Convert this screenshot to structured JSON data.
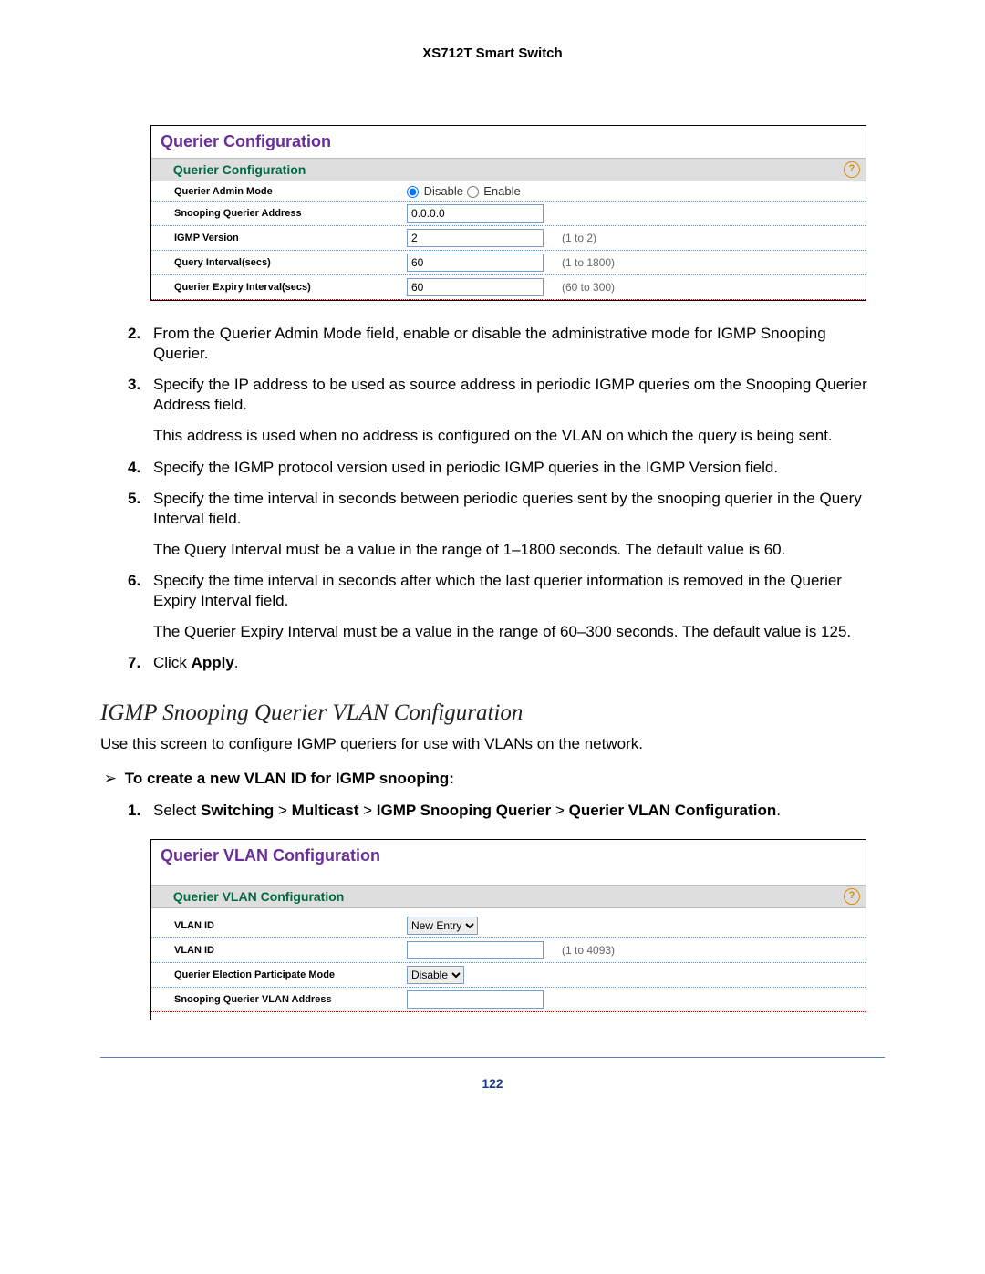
{
  "header": "XS712T Smart Switch",
  "panel1": {
    "title": "Querier Configuration",
    "subtitle": "Querier Configuration",
    "rows": {
      "admin_mode_label": "Querier Admin Mode",
      "disable": "Disable",
      "enable": "Enable",
      "snoop_addr_label": "Snooping Querier Address",
      "snoop_addr_val": "0.0.0.0",
      "igmp_ver_label": "IGMP Version",
      "igmp_ver_val": "2",
      "igmp_ver_hint": "(1 to 2)",
      "query_int_label": "Query Interval(secs)",
      "query_int_val": "60",
      "query_int_hint": "(1 to 1800)",
      "expiry_label": "Querier Expiry Interval(secs)",
      "expiry_val": "60",
      "expiry_hint": "(60 to 300)"
    }
  },
  "steps1": {
    "s2_num": "2.",
    "s2": "From the Querier Admin Mode field, enable or disable the administrative mode for IGMP Snooping Querier.",
    "s3_num": "3.",
    "s3": "Specify the IP address to be used as source address in periodic IGMP queries om the Snooping Querier Address field.",
    "s3p": "This address is used when no address is configured on the VLAN on which the query is being sent.",
    "s4_num": "4.",
    "s4": "Specify the IGMP protocol version used in periodic IGMP queries in the IGMP Version field.",
    "s5_num": "5.",
    "s5": "Specify the time interval in seconds between periodic queries sent by the snooping querier in the Query Interval field.",
    "s5p": "The Query Interval must be a value in the range of 1–1800 seconds. The default value is 60.",
    "s6_num": "6.",
    "s6": "Specify the time interval in seconds after which the last querier information is removed in the Querier Expiry Interval field.",
    "s6p": "The Querier Expiry Interval must be a value in the range of 60–300 seconds. The default value is 125.",
    "s7_num": "7.",
    "s7a": "Click ",
    "s7b": "Apply",
    "s7c": "."
  },
  "section2": {
    "heading": "IGMP Snooping Querier VLAN Configuration",
    "intro": "Use this screen to configure IGMP queriers for use with VLANs on the network.",
    "arrow_text": "To create a new VLAN ID for IGMP snooping:",
    "step1_num": "1.",
    "step1_a": "Select ",
    "step1_b": "Switching",
    "step1_c": "Multicast",
    "step1_d": "IGMP Snooping Querier",
    "step1_e": "Querier VLAN Configuration",
    "gt": ">"
  },
  "panel2": {
    "title": "Querier VLAN Configuration",
    "subtitle": "Querier VLAN Configuration",
    "rows": {
      "vlan1_label": "VLAN ID",
      "vlan1_val": "New Entry",
      "vlan2_label": "VLAN ID",
      "vlan2_hint": "(1 to 4093)",
      "mode_label": "Querier Election Participate Mode",
      "mode_val": "Disable",
      "addr_label": "Snooping Querier VLAN Address"
    }
  },
  "page_number": "122"
}
